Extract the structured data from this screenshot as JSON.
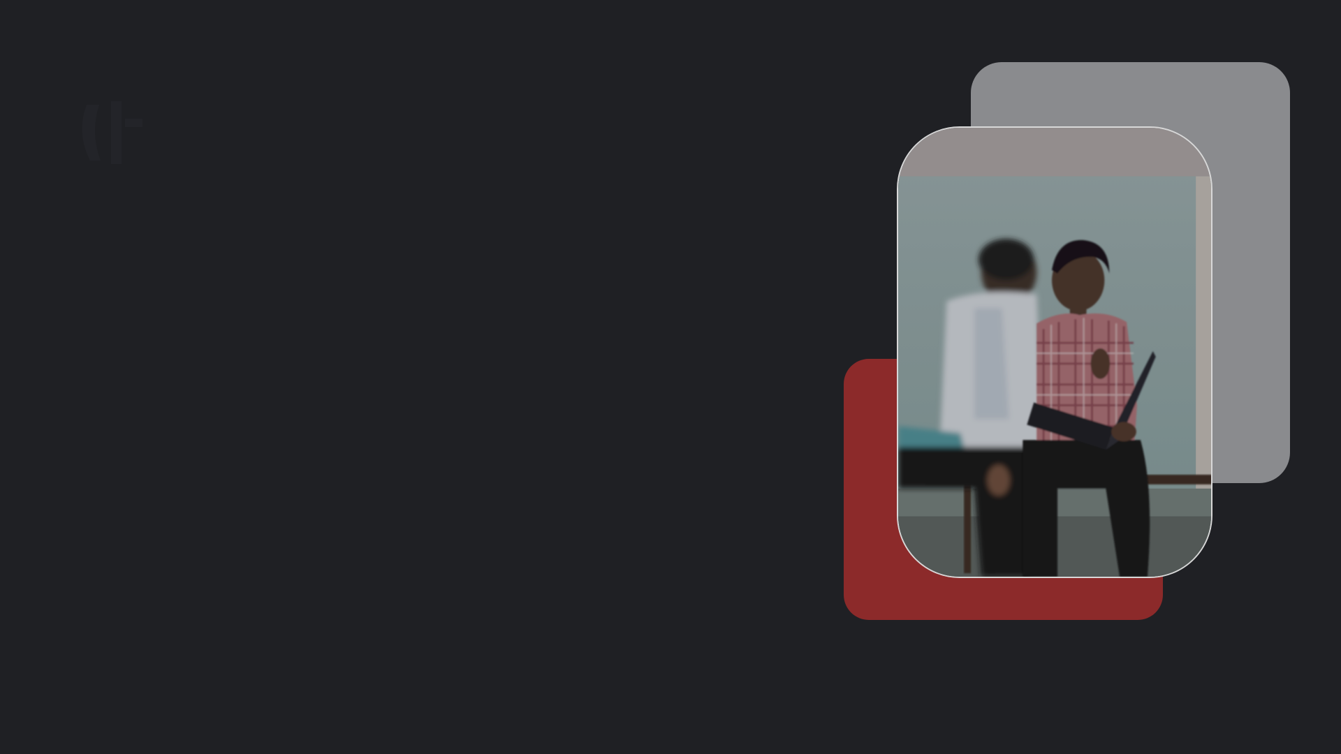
{
  "theme": {
    "background": "#1f2024",
    "card_gray": "#8a8b8e",
    "card_red": "#8c2a2a",
    "photo_border": "#d8d8d8"
  },
  "logo": {
    "icon": "logo-mark-icon"
  },
  "photo": {
    "subject": "two-students-reviewing-laptop"
  }
}
